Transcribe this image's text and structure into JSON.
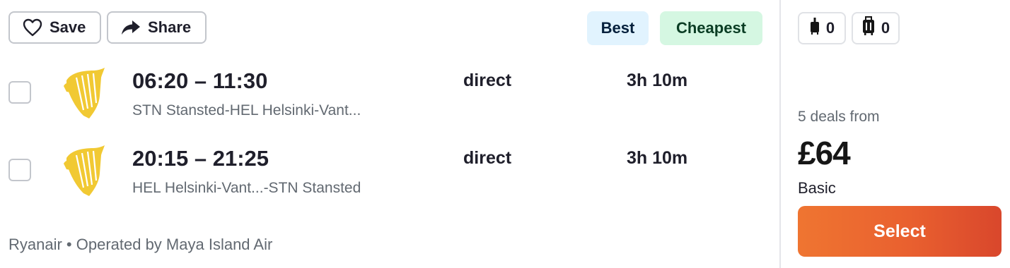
{
  "actions": {
    "save_label": "Save",
    "share_label": "Share"
  },
  "tags": {
    "best": "Best",
    "cheapest": "Cheapest"
  },
  "flights": [
    {
      "times": "06:20 – 11:30",
      "route": "STN Stansted-HEL Helsinki-Vant...",
      "stops": "direct",
      "duration": "3h 10m",
      "airline_logo": "ryanair-harp-icon"
    },
    {
      "times": "20:15 – 21:25",
      "route": "HEL Helsinki-Vant...-STN Stansted",
      "stops": "direct",
      "duration": "3h 10m",
      "airline_logo": "ryanair-harp-icon"
    }
  ],
  "operator_text": "Ryanair • Operated by Maya Island Air",
  "baggage": {
    "cabin_count": "0",
    "checked_count": "0"
  },
  "pricing": {
    "deals_text": "5 deals from",
    "price": "£64",
    "fare_type": "Basic",
    "select_label": "Select"
  },
  "colors": {
    "accent": "#e9602f",
    "best_bg": "#e1f3fe",
    "cheapest_bg": "#d5f7e2",
    "logo_yellow": "#f1c933"
  }
}
